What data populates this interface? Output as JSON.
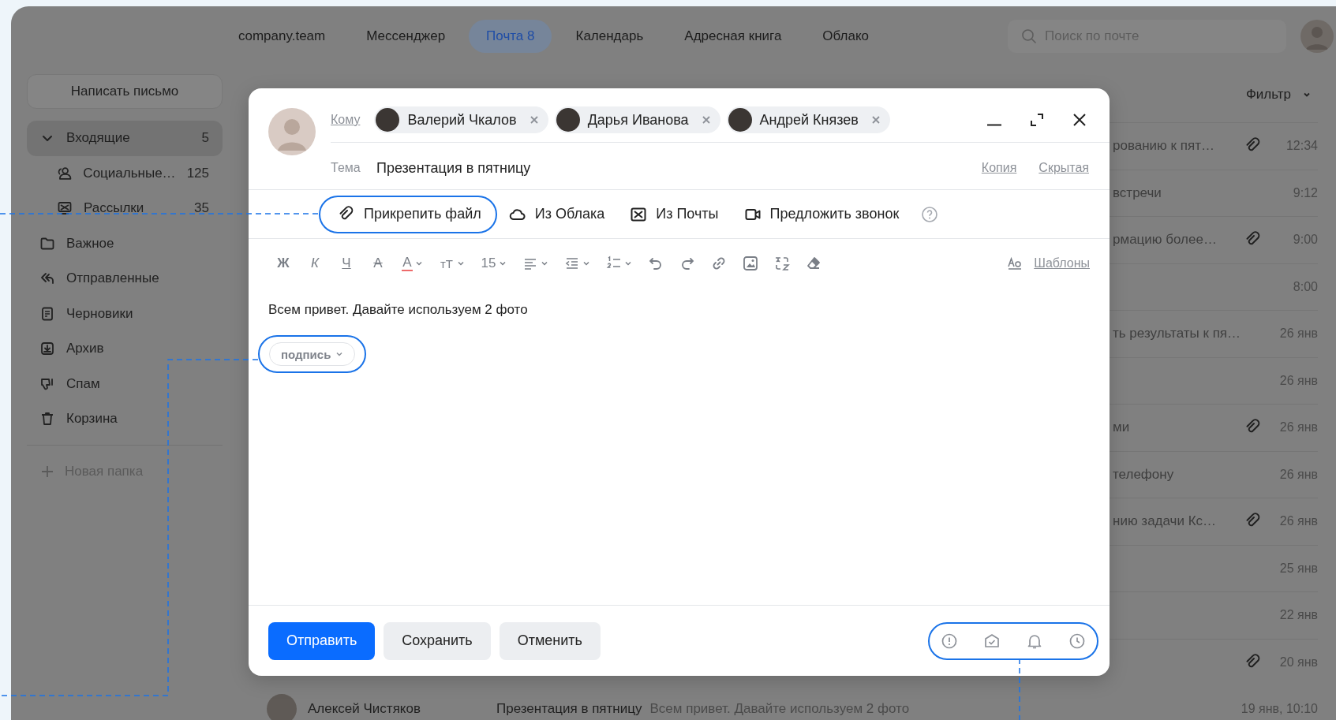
{
  "nav": {
    "items": [
      {
        "label": "company.team",
        "selected": false
      },
      {
        "label": "Мессенджер",
        "selected": false
      },
      {
        "label": "Почта 8",
        "selected": true
      },
      {
        "label": "Календарь",
        "selected": false
      },
      {
        "label": "Адресная книга",
        "selected": false
      },
      {
        "label": "Облако",
        "selected": false
      }
    ]
  },
  "search": {
    "placeholder": "Поиск по почте"
  },
  "sidebar": {
    "compose_button": "Написать письмо",
    "folders": [
      {
        "label": "Входящие",
        "count": "5",
        "selected": true,
        "expanded": true,
        "children": [
          {
            "kind": "social",
            "label": "Социальные…",
            "count": "125",
            "selected": false
          },
          {
            "kind": "newsletter",
            "label": "Рассылки",
            "count": "35",
            "selected": false
          }
        ]
      },
      {
        "kind": "folder",
        "label": "Важное",
        "selected": false
      },
      {
        "kind": "sent",
        "label": "Отправленные",
        "selected": false
      },
      {
        "kind": "drafts",
        "label": "Черновики",
        "selected": false
      },
      {
        "kind": "archive",
        "label": "Архив",
        "selected": false
      },
      {
        "kind": "spam",
        "label": "Спам",
        "selected": false
      },
      {
        "kind": "trash",
        "label": "Корзина",
        "selected": false
      }
    ],
    "new_folder": "Новая папка"
  },
  "filter": {
    "label": "Фильтр"
  },
  "messages": [
    {
      "kind": "partial",
      "preview": "рованию к пят…",
      "attachment": true,
      "time": "12:34"
    },
    {
      "kind": "partial",
      "preview": "встречи",
      "attachment": false,
      "time": "9:12"
    },
    {
      "kind": "partial",
      "preview": "рмацию более…",
      "attachment": true,
      "time": "9:00"
    },
    {
      "kind": "partial",
      "attachment": false,
      "time": "8:00"
    },
    {
      "kind": "partial",
      "preview": "ть результаты к пя…",
      "attachment": false,
      "time": "26 янв"
    },
    {
      "kind": "partial",
      "attachment": false,
      "time": "26 янв"
    },
    {
      "kind": "partial",
      "preview": "ми",
      "attachment": true,
      "time": "26 янв"
    },
    {
      "kind": "partial",
      "preview": "телефону",
      "attachment": false,
      "time": "26 янв"
    },
    {
      "kind": "partial",
      "preview": "нию задачи Кс…",
      "attachment": true,
      "time": "26 янв"
    },
    {
      "kind": "partial",
      "attachment": false,
      "time": "25 янв"
    },
    {
      "kind": "partial",
      "attachment": false,
      "time": "22 янв"
    },
    {
      "kind": "partial",
      "attachment": true,
      "time": "20 янв"
    },
    {
      "kind": "full",
      "sender": "Алексей Чистяков",
      "subject": "Презентация в пятницу",
      "preview": "Всем привет. Давайте используем 2 фото",
      "attachment": false,
      "time": "19 янв, 10:10"
    }
  ],
  "compose": {
    "to_label": "Кому",
    "recipients": [
      {
        "name": "Валерий Чкалов"
      },
      {
        "name": "Дарья Иванова"
      },
      {
        "name": "Андрей Князев"
      }
    ],
    "subject_label": "Тема",
    "subject": "Презентация в пятницу",
    "cc": "Копия",
    "bcc": "Скрытая",
    "attach_actions": [
      {
        "kind": "file",
        "label": "Прикрепить файл"
      },
      {
        "kind": "cloud",
        "label": "Из Облака"
      },
      {
        "kind": "mail",
        "label": "Из Почты"
      },
      {
        "kind": "call",
        "label": "Предложить звонок"
      }
    ],
    "format_toolbar": [
      {
        "kind": "bold",
        "label": "Ж"
      },
      {
        "kind": "italic",
        "label": "К"
      },
      {
        "kind": "underline",
        "label": "Ч"
      },
      {
        "kind": "strike",
        "label": "A"
      },
      {
        "kind": "color",
        "label": "A"
      },
      {
        "kind": "case",
        "label": "тT"
      },
      {
        "kind": "size",
        "label": "15"
      },
      {
        "kind": "align"
      },
      {
        "kind": "indent"
      },
      {
        "kind": "list"
      },
      {
        "kind": "undo"
      },
      {
        "kind": "redo"
      },
      {
        "kind": "link"
      },
      {
        "kind": "image"
      },
      {
        "kind": "translate"
      },
      {
        "kind": "eraser"
      }
    ],
    "templates": "Шаблоны",
    "body": "Всем привет. Давайте используем 2 фото",
    "signature": "подпись",
    "buttons": [
      {
        "kind": "primary",
        "label": "Отправить"
      },
      {
        "kind": "secondary",
        "label": "Сохранить"
      },
      {
        "kind": "secondary",
        "label": "Отменить"
      }
    ]
  }
}
